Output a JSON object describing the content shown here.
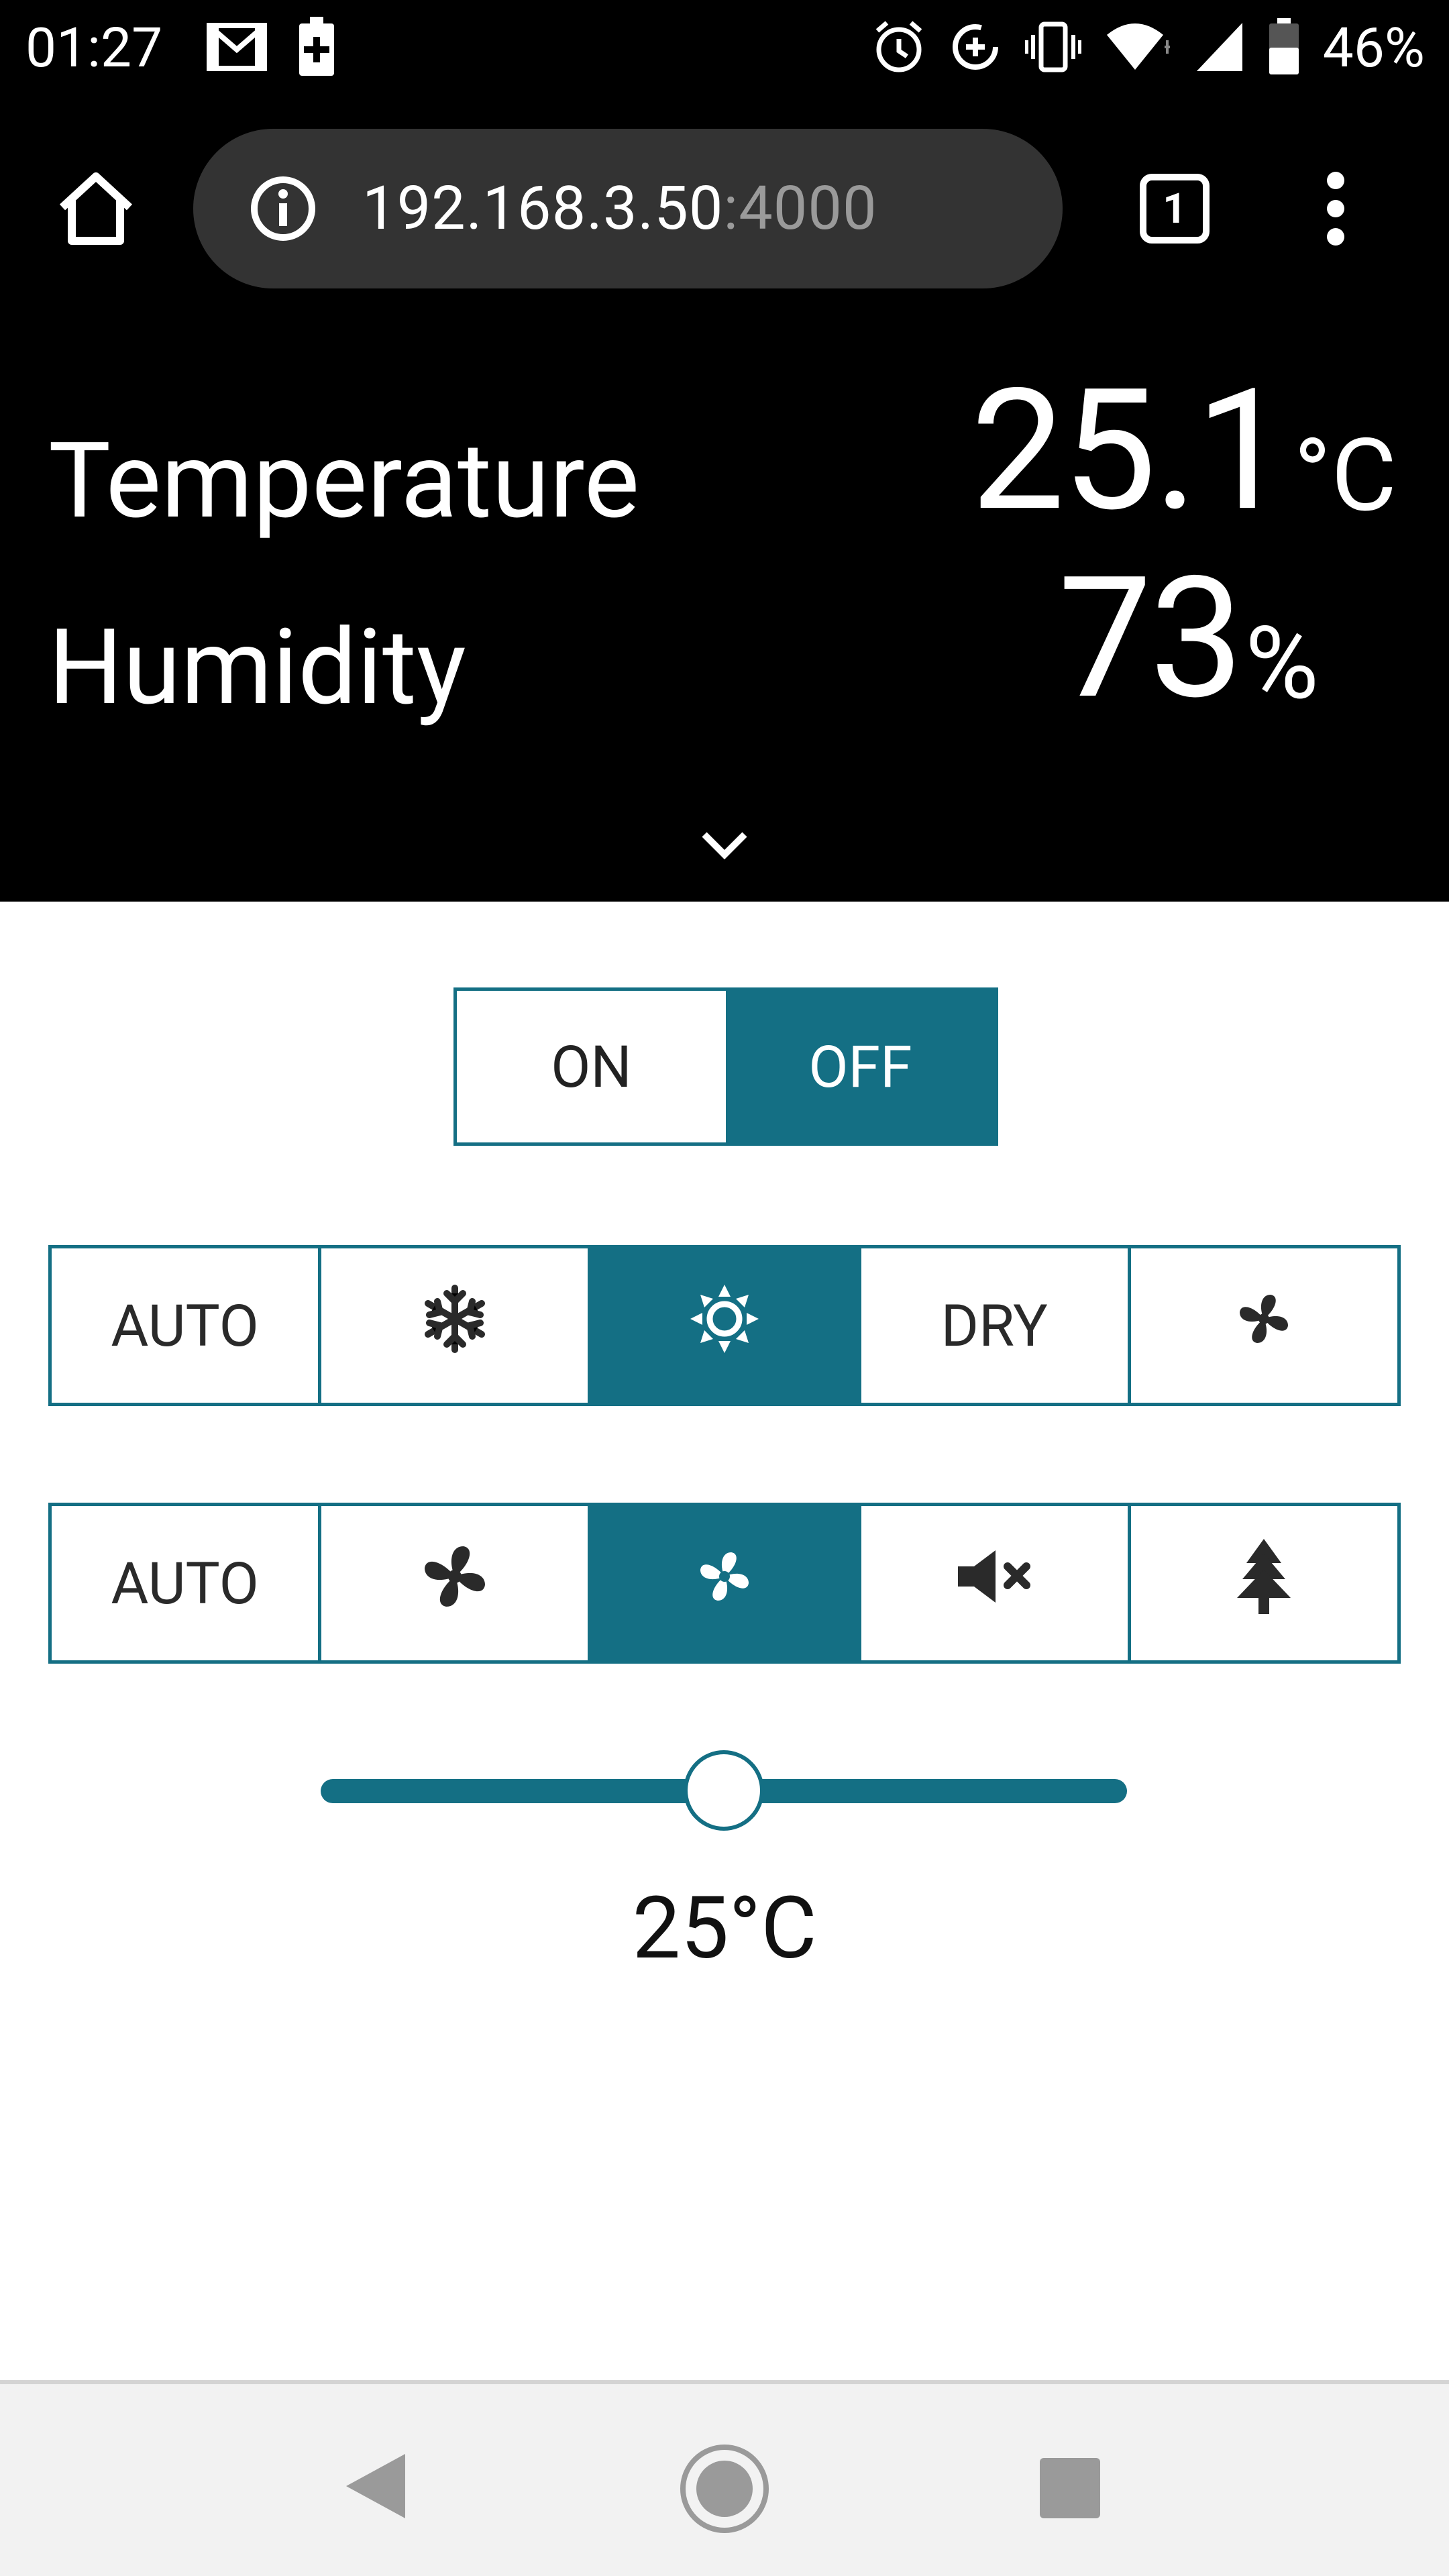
{
  "status_bar": {
    "time": "01:27",
    "battery_percent": "46%",
    "left_icons": [
      "gmail-icon",
      "battery-saver-icon"
    ],
    "right_icons": [
      "alarm-icon",
      "data-saver-icon",
      "vibrate-icon",
      "wifi-icon",
      "signal-icon",
      "battery-icon"
    ]
  },
  "browser": {
    "url_host": "192.168.3.50",
    "url_port": ":4000",
    "tab_count": "1",
    "icons": [
      "home-icon",
      "info-icon",
      "tabs-icon",
      "overflow-menu-icon"
    ]
  },
  "sensor": {
    "temperature_label": "Temperature",
    "temperature_value": "25.1",
    "temperature_unit": "°C",
    "humidity_label": "Humidity",
    "humidity_value": "73",
    "humidity_unit": "%"
  },
  "power": {
    "on_label": "ON",
    "off_label": "OFF",
    "selected": "OFF"
  },
  "mode": {
    "auto_label": "AUTO",
    "dry_label": "DRY",
    "options": [
      "AUTO",
      "cool-icon",
      "heat-icon",
      "DRY",
      "fan-icon"
    ],
    "selected": "heat-icon"
  },
  "fan_speed": {
    "auto_label": "AUTO",
    "options": [
      "AUTO",
      "fan-high-icon",
      "fan-low-icon",
      "quiet-icon",
      "natural-wind-icon"
    ],
    "selected": "fan-low-icon"
  },
  "setpoint": {
    "value_label": "25°C",
    "slider_fraction": 0.5
  },
  "colors": {
    "accent": "#146f84",
    "header_bg": "#000000",
    "page_bg": "#ffffff"
  }
}
